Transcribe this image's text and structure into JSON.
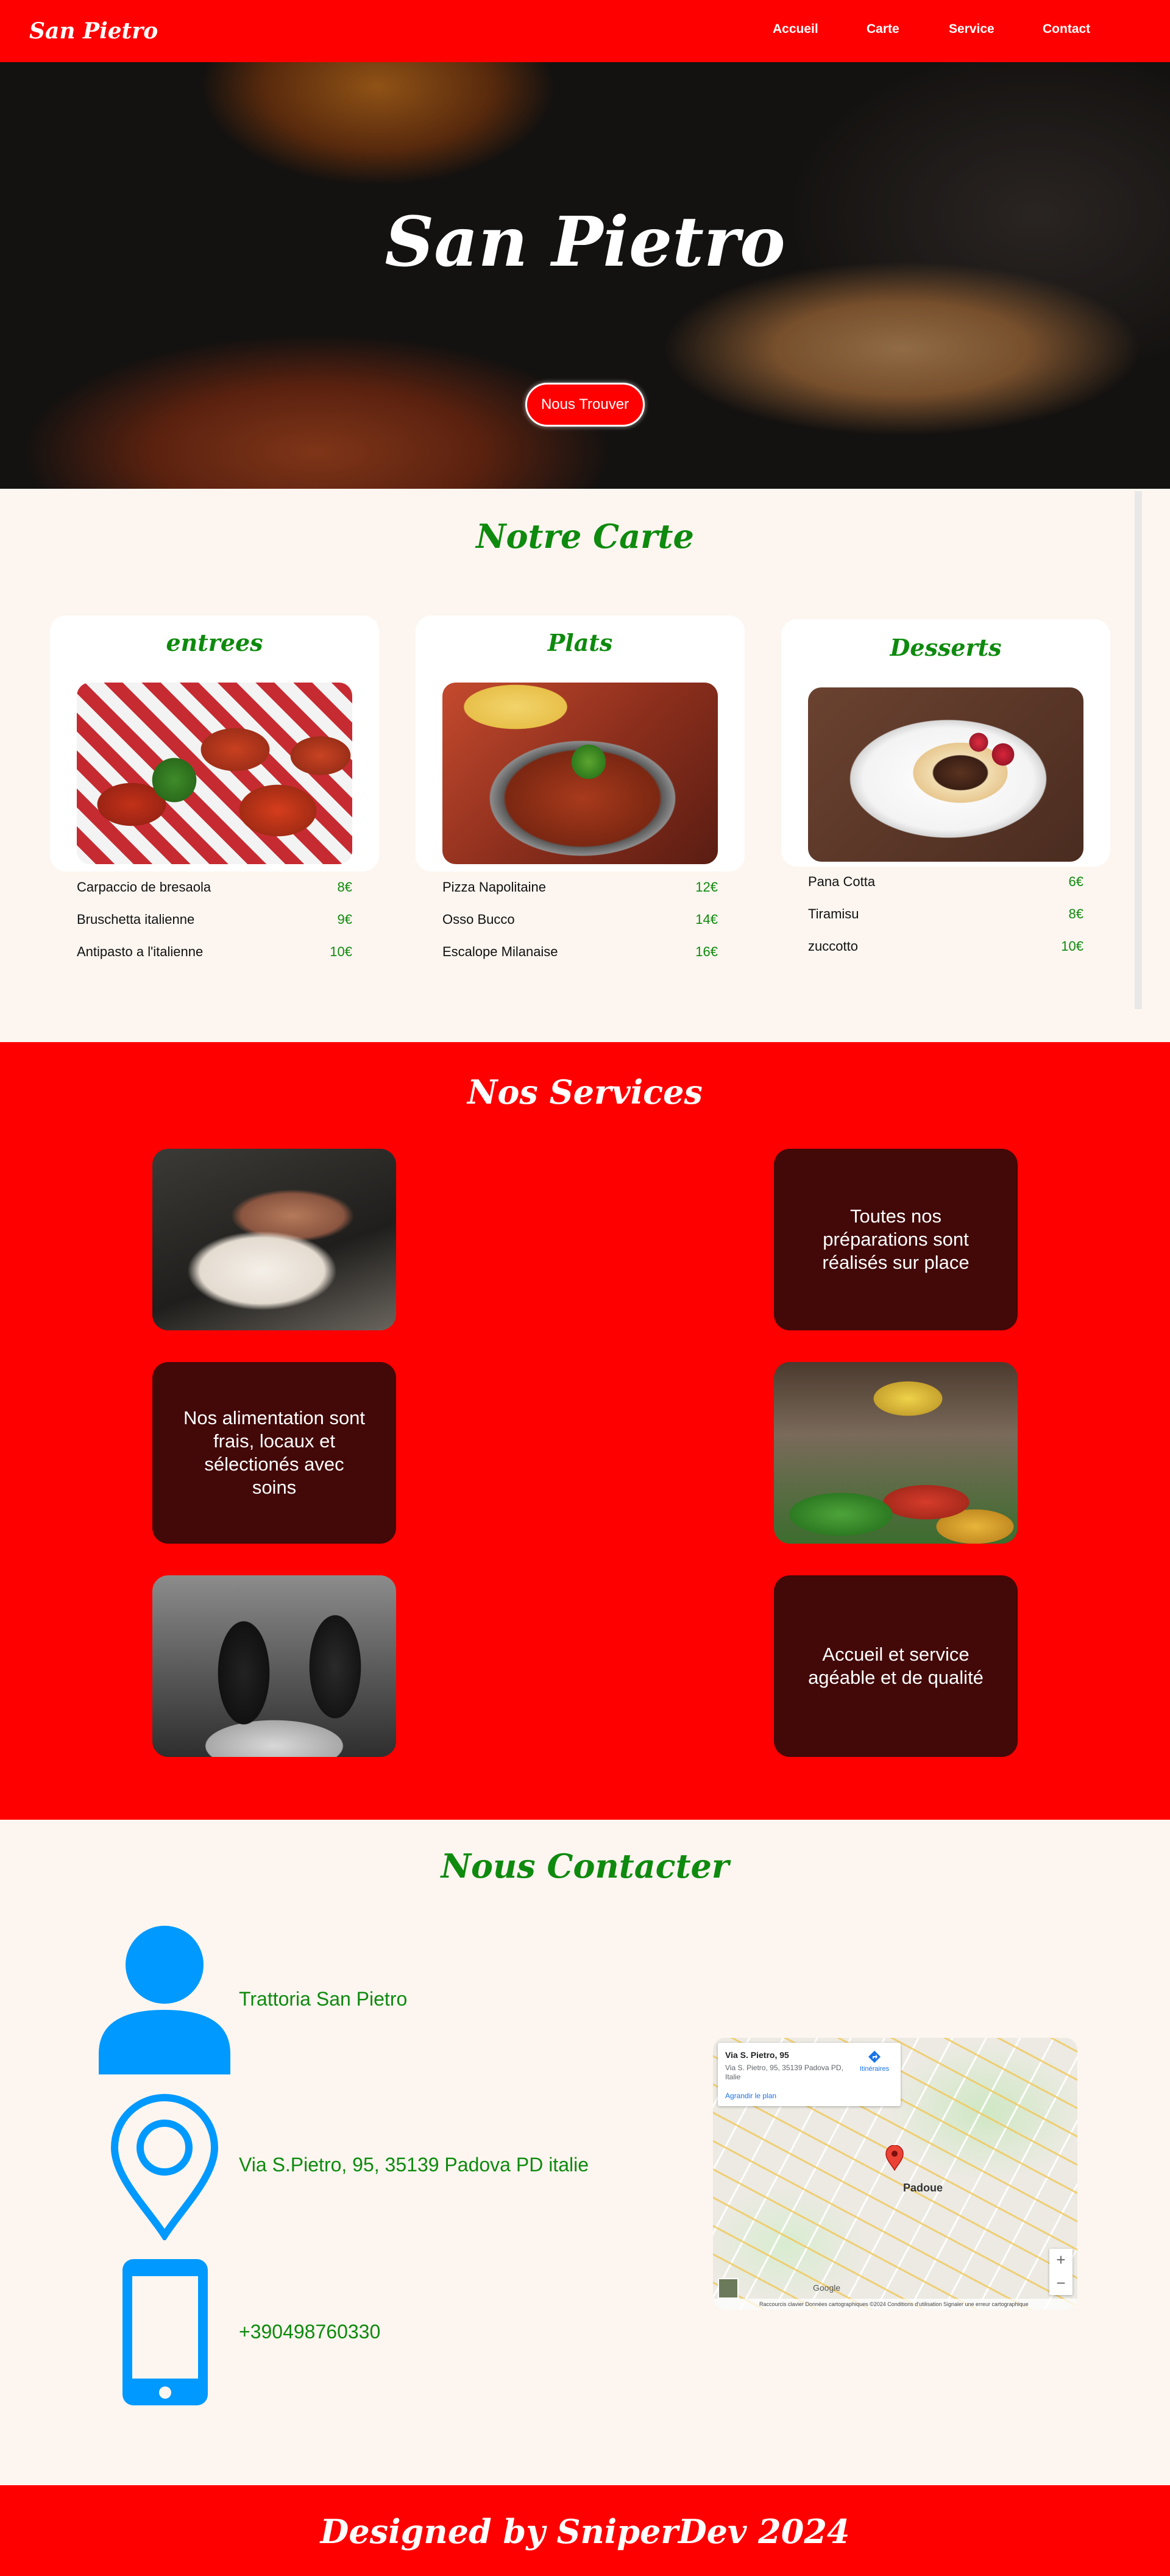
{
  "nav": {
    "brand": "San Pietro",
    "links": [
      "Accueil",
      "Carte",
      "Service",
      "Contact"
    ]
  },
  "hero": {
    "title": "San Pietro",
    "button": "Nous Trouver"
  },
  "menu": {
    "title": "Notre Carte",
    "categories": [
      {
        "name": "entrees",
        "image": "bruschetta-photo",
        "items": [
          {
            "name": "Carpaccio de bresaola",
            "price": "8€"
          },
          {
            "name": "Bruschetta italienne",
            "price": "9€"
          },
          {
            "name": "Antipasto a l'italienne",
            "price": "10€"
          }
        ]
      },
      {
        "name": "Plats",
        "image": "stew-photo",
        "items": [
          {
            "name": "Pizza Napolitaine",
            "price": "12€"
          },
          {
            "name": "Osso Bucco",
            "price": "14€"
          },
          {
            "name": "Escalope Milanaise",
            "price": "16€"
          }
        ]
      },
      {
        "name": "Desserts",
        "image": "tiramisu-photo",
        "items": [
          {
            "name": "Pana Cotta",
            "price": "6€"
          },
          {
            "name": "Tiramisu",
            "price": "8€"
          },
          {
            "name": "zuccotto",
            "price": "10€"
          }
        ]
      }
    ]
  },
  "services": {
    "title": "Nos Services",
    "items": [
      "Toutes nos préparations sont réalisés sur place",
      "Nos alimentation sont frais, locaux et sélectionés avec soins",
      "Accueil et service agéable et de qualité"
    ]
  },
  "contact": {
    "title": "Nous Contacter",
    "name": "Trattoria San Pietro",
    "address": "Via S.Pietro, 95, 35139 Padova PD italie",
    "phone": "+390498760330",
    "map": {
      "place": "Via S. Pietro, 95",
      "address": "Via S. Pietro, 95, 35139 Padova PD, Italie",
      "enlarge": "Agrandir le plan",
      "directions": "Itinéraires",
      "city": "Padoue",
      "zoom_in": "+",
      "zoom_out": "−",
      "google": "Google",
      "footer": "Raccourcis clavier   Données cartographiques ©2024   Conditions d'utilisation   Signaler une erreur cartographique"
    }
  },
  "footer": {
    "text": "Designed by SniperDev 2024"
  },
  "colors": {
    "primary": "#ff0000",
    "accent": "#0e8a0e",
    "dark_card": "#430808",
    "icon_blue": "#0099ff",
    "background": "#fdf6f0"
  }
}
